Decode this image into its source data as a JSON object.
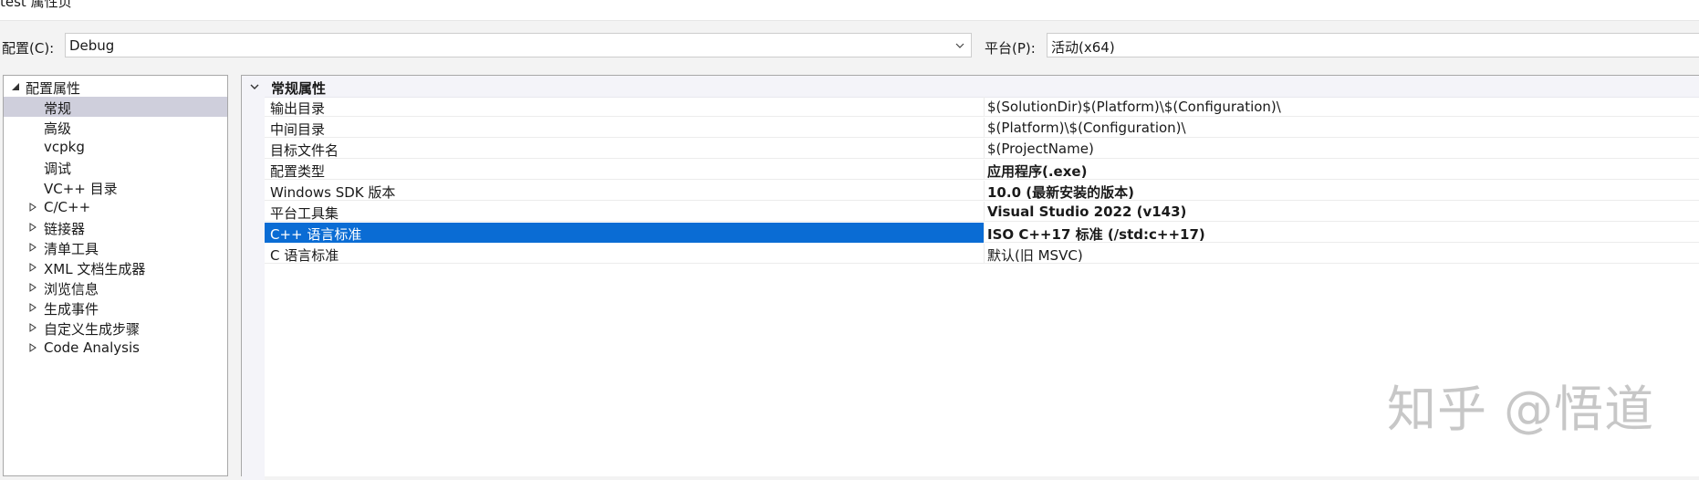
{
  "window": {
    "title": "test 属性页"
  },
  "toolbar": {
    "config_label": "配置(C):",
    "config_value": "Debug",
    "platform_label": "平台(P):",
    "platform_value": "活动(x64)"
  },
  "tree": {
    "root": "配置属性",
    "items": [
      {
        "label": "常规",
        "selected": true
      },
      {
        "label": "高级"
      },
      {
        "label": "vcpkg"
      },
      {
        "label": "调试"
      },
      {
        "label": "VC++ 目录"
      },
      {
        "label": "C/C++",
        "expandable": true
      },
      {
        "label": "链接器",
        "expandable": true
      },
      {
        "label": "清单工具",
        "expandable": true
      },
      {
        "label": "XML 文档生成器",
        "expandable": true
      },
      {
        "label": "浏览信息",
        "expandable": true
      },
      {
        "label": "生成事件",
        "expandable": true
      },
      {
        "label": "自定义生成步骤",
        "expandable": true
      },
      {
        "label": "Code Analysis",
        "expandable": true
      }
    ]
  },
  "properties": {
    "category": "常规属性",
    "rows": [
      {
        "name": "输出目录",
        "value": "$(SolutionDir)$(Platform)\\$(Configuration)\\"
      },
      {
        "name": "中间目录",
        "value": "$(Platform)\\$(Configuration)\\"
      },
      {
        "name": "目标文件名",
        "value": "$(ProjectName)"
      },
      {
        "name": "配置类型",
        "value": "应用程序(.exe)",
        "bold": true
      },
      {
        "name": "Windows SDK 版本",
        "value": "10.0 (最新安装的版本)",
        "bold": true
      },
      {
        "name": "平台工具集",
        "value": "Visual Studio 2022 (v143)",
        "bold": true
      },
      {
        "name": "C++ 语言标准",
        "value": "ISO C++17 标准 (/std:c++17)",
        "bold": true,
        "selected": true
      },
      {
        "name": "C 语言标准",
        "value": "默认(旧 MSVC)"
      }
    ]
  },
  "watermark": "知乎 @悟道",
  "colors": {
    "selection": "#0a6cd4",
    "tree_selection": "#cfcfdc"
  }
}
